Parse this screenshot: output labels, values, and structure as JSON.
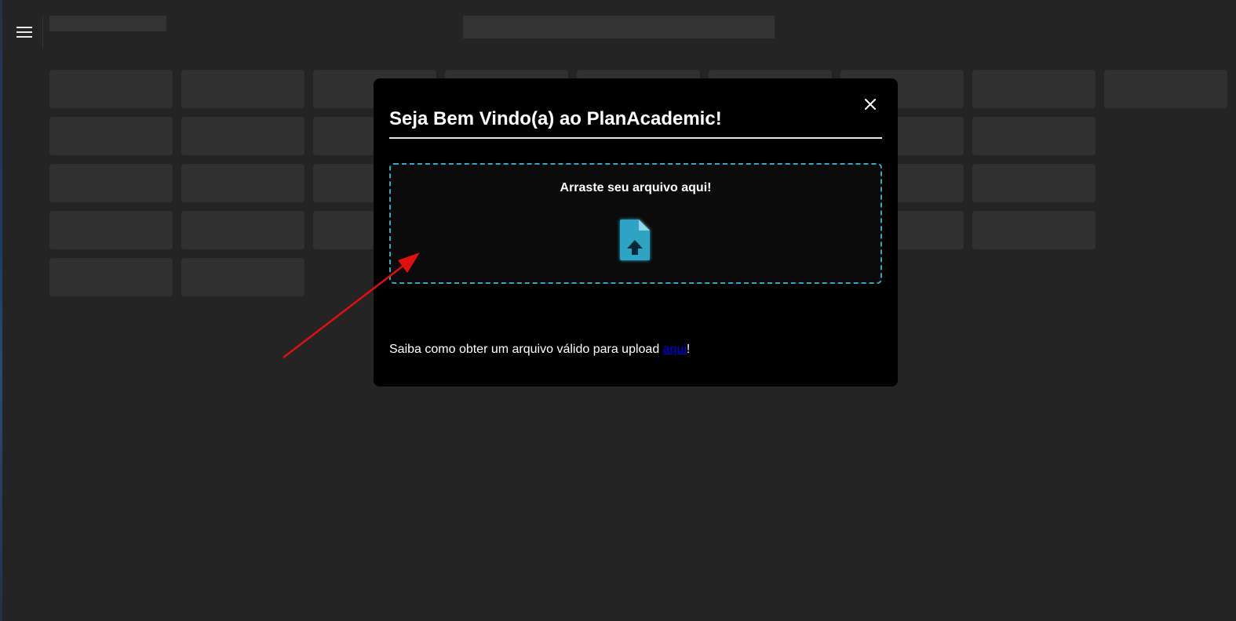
{
  "app": {
    "menu_icon": "hamburger-menu-icon"
  },
  "modal": {
    "title": "Seja Bem Vindo(a) ao PlanAcademic!",
    "close_icon": "close-icon",
    "dropzone": {
      "label": "Arraste seu arquivo aqui!",
      "icon": "file-upload-icon",
      "accent_color": "#35a7c4"
    },
    "help_text_before": "Saiba como obter um arquivo válido para upload ",
    "help_link_label": "aqui",
    "help_text_after": "!"
  },
  "annotation": {
    "color": "#e01010"
  }
}
